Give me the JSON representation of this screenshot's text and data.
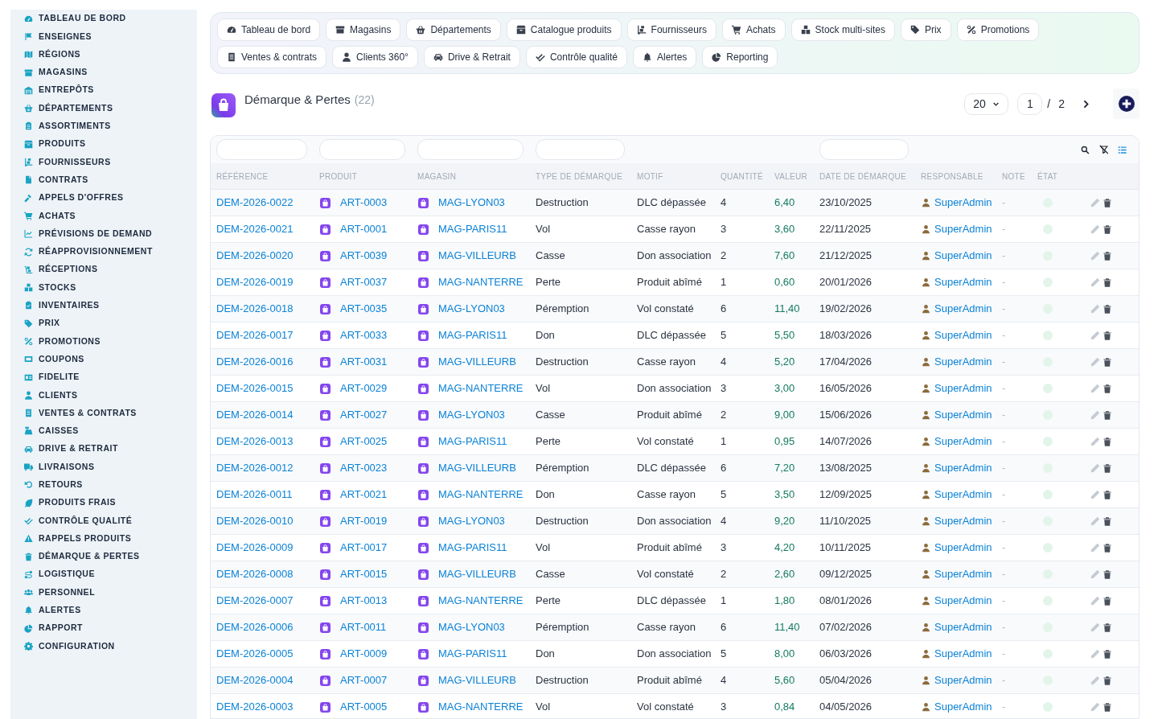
{
  "sidebar": {
    "items": [
      "TABLEAU DE BORD",
      "ENSEIGNES",
      "RÉGIONS",
      "MAGASINS",
      "ENTREPÔTS",
      "DÉPARTEMENTS",
      "ASSORTIMENTS",
      "PRODUITS",
      "FOURNISSEURS",
      "CONTRATS",
      "APPELS D'OFFRES",
      "ACHATS",
      "PRÉVISIONS DE DEMAND",
      "RÉAPPROVISIONNEMENT",
      "RÉCEPTIONS",
      "STOCKS",
      "INVENTAIRES",
      "PRIX",
      "PROMOTIONS",
      "COUPONS",
      "FIDELITE",
      "CLIENTS",
      "VENTES & CONTRATS",
      "CAISSES",
      "DRIVE & RETRAIT",
      "LIVRAISONS",
      "RETOURS",
      "PRODUITS FRAIS",
      "CONTRÔLE QUALITÉ",
      "RAPPELS PRODUITS",
      "DÉMARQUE & PERTES",
      "LOGISTIQUE",
      "PERSONNEL",
      "ALERTES",
      "RAPPORT",
      "CONFIGURATION"
    ]
  },
  "nav_tabs": [
    "Tableau de bord",
    "Magasins",
    "Départements",
    "Catalogue produits",
    "Fournisseurs",
    "Achats",
    "Stock multi-sites",
    "Prix",
    "Promotions",
    "Ventes & contrats",
    "Clients 360°",
    "Drive & Retrait",
    "Contrôle qualité",
    "Alertes",
    "Reporting"
  ],
  "page_header": {
    "title": "Démarque & Pertes",
    "count": "(22)"
  },
  "pagination": {
    "page_size": "20",
    "page": "1",
    "separator": "/",
    "total_pages": "2"
  },
  "table": {
    "columns": [
      {
        "label": "RÉFÉRENCE",
        "filterable": true
      },
      {
        "label": "PRODUIT",
        "filterable": true
      },
      {
        "label": "MAGASIN",
        "filterable": true
      },
      {
        "label": "TYPE DE DÉMARQUE",
        "filterable": true
      },
      {
        "label": "MOTIF",
        "filterable": false
      },
      {
        "label": "QUANTITÉ",
        "filterable": false
      },
      {
        "label": "VALEUR",
        "filterable": false
      },
      {
        "label": "DATE DE DÉMARQUE",
        "filterable": true
      },
      {
        "label": "RESPONSABLE",
        "filterable": false
      },
      {
        "label": "NOTE",
        "filterable": false
      },
      {
        "label": "ÉTAT",
        "filterable": false
      }
    ],
    "rows": [
      {
        "reference": "DEM-2026-0022",
        "product": "ART-0003",
        "store": "MAG-LYON03",
        "type": "Destruction",
        "reason": "DLC dépassée",
        "quantity": "4",
        "value": "6,40",
        "date": "23/10/2025",
        "owner": "SuperAdmin",
        "note": "-"
      },
      {
        "reference": "DEM-2026-0021",
        "product": "ART-0001",
        "store": "MAG-PARIS11",
        "type": "Vol",
        "reason": "Casse rayon",
        "quantity": "3",
        "value": "3,60",
        "date": "22/11/2025",
        "owner": "SuperAdmin",
        "note": "-"
      },
      {
        "reference": "DEM-2026-0020",
        "product": "ART-0039",
        "store": "MAG-VILLEURB",
        "type": "Casse",
        "reason": "Don association",
        "quantity": "2",
        "value": "7,60",
        "date": "21/12/2025",
        "owner": "SuperAdmin",
        "note": "-"
      },
      {
        "reference": "DEM-2026-0019",
        "product": "ART-0037",
        "store": "MAG-NANTERRE",
        "type": "Perte",
        "reason": "Produit abîmé",
        "quantity": "1",
        "value": "0,60",
        "date": "20/01/2026",
        "owner": "SuperAdmin",
        "note": "-"
      },
      {
        "reference": "DEM-2026-0018",
        "product": "ART-0035",
        "store": "MAG-LYON03",
        "type": "Péremption",
        "reason": "Vol constaté",
        "quantity": "6",
        "value": "11,40",
        "date": "19/02/2026",
        "owner": "SuperAdmin",
        "note": "-"
      },
      {
        "reference": "DEM-2026-0017",
        "product": "ART-0033",
        "store": "MAG-PARIS11",
        "type": "Don",
        "reason": "DLC dépassée",
        "quantity": "5",
        "value": "5,50",
        "date": "18/03/2026",
        "owner": "SuperAdmin",
        "note": "-"
      },
      {
        "reference": "DEM-2026-0016",
        "product": "ART-0031",
        "store": "MAG-VILLEURB",
        "type": "Destruction",
        "reason": "Casse rayon",
        "quantity": "4",
        "value": "5,20",
        "date": "17/04/2026",
        "owner": "SuperAdmin",
        "note": "-"
      },
      {
        "reference": "DEM-2026-0015",
        "product": "ART-0029",
        "store": "MAG-NANTERRE",
        "type": "Vol",
        "reason": "Don association",
        "quantity": "3",
        "value": "3,00",
        "date": "16/05/2026",
        "owner": "SuperAdmin",
        "note": "-"
      },
      {
        "reference": "DEM-2026-0014",
        "product": "ART-0027",
        "store": "MAG-LYON03",
        "type": "Casse",
        "reason": "Produit abîmé",
        "quantity": "2",
        "value": "9,00",
        "date": "15/06/2026",
        "owner": "SuperAdmin",
        "note": "-"
      },
      {
        "reference": "DEM-2026-0013",
        "product": "ART-0025",
        "store": "MAG-PARIS11",
        "type": "Perte",
        "reason": "Vol constaté",
        "quantity": "1",
        "value": "0,95",
        "date": "14/07/2026",
        "owner": "SuperAdmin",
        "note": "-"
      },
      {
        "reference": "DEM-2026-0012",
        "product": "ART-0023",
        "store": "MAG-VILLEURB",
        "type": "Péremption",
        "reason": "DLC dépassée",
        "quantity": "6",
        "value": "7,20",
        "date": "13/08/2025",
        "owner": "SuperAdmin",
        "note": "-"
      },
      {
        "reference": "DEM-2026-0011",
        "product": "ART-0021",
        "store": "MAG-NANTERRE",
        "type": "Don",
        "reason": "Casse rayon",
        "quantity": "5",
        "value": "3,50",
        "date": "12/09/2025",
        "owner": "SuperAdmin",
        "note": "-"
      },
      {
        "reference": "DEM-2026-0010",
        "product": "ART-0019",
        "store": "MAG-LYON03",
        "type": "Destruction",
        "reason": "Don association",
        "quantity": "4",
        "value": "9,20",
        "date": "11/10/2025",
        "owner": "SuperAdmin",
        "note": "-"
      },
      {
        "reference": "DEM-2026-0009",
        "product": "ART-0017",
        "store": "MAG-PARIS11",
        "type": "Vol",
        "reason": "Produit abîmé",
        "quantity": "3",
        "value": "4,20",
        "date": "10/11/2025",
        "owner": "SuperAdmin",
        "note": "-"
      },
      {
        "reference": "DEM-2026-0008",
        "product": "ART-0015",
        "store": "MAG-VILLEURB",
        "type": "Casse",
        "reason": "Vol constaté",
        "quantity": "2",
        "value": "2,60",
        "date": "09/12/2025",
        "owner": "SuperAdmin",
        "note": "-"
      },
      {
        "reference": "DEM-2026-0007",
        "product": "ART-0013",
        "store": "MAG-NANTERRE",
        "type": "Perte",
        "reason": "DLC dépassée",
        "quantity": "1",
        "value": "1,80",
        "date": "08/01/2026",
        "owner": "SuperAdmin",
        "note": "-"
      },
      {
        "reference": "DEM-2026-0006",
        "product": "ART-0011",
        "store": "MAG-LYON03",
        "type": "Péremption",
        "reason": "Casse rayon",
        "quantity": "6",
        "value": "11,40",
        "date": "07/02/2026",
        "owner": "SuperAdmin",
        "note": "-"
      },
      {
        "reference": "DEM-2026-0005",
        "product": "ART-0009",
        "store": "MAG-PARIS11",
        "type": "Don",
        "reason": "Don association",
        "quantity": "5",
        "value": "8,00",
        "date": "06/03/2026",
        "owner": "SuperAdmin",
        "note": "-"
      },
      {
        "reference": "DEM-2026-0004",
        "product": "ART-0007",
        "store": "MAG-VILLEURB",
        "type": "Destruction",
        "reason": "Produit abîmé",
        "quantity": "4",
        "value": "5,60",
        "date": "05/04/2026",
        "owner": "SuperAdmin",
        "note": "-"
      },
      {
        "reference": "DEM-2026-0003",
        "product": "ART-0005",
        "store": "MAG-NANTERRE",
        "type": "Vol",
        "reason": "Vol constaté",
        "quantity": "3",
        "value": "0,84",
        "date": "04/05/2026",
        "owner": "SuperAdmin",
        "note": "-"
      }
    ]
  }
}
